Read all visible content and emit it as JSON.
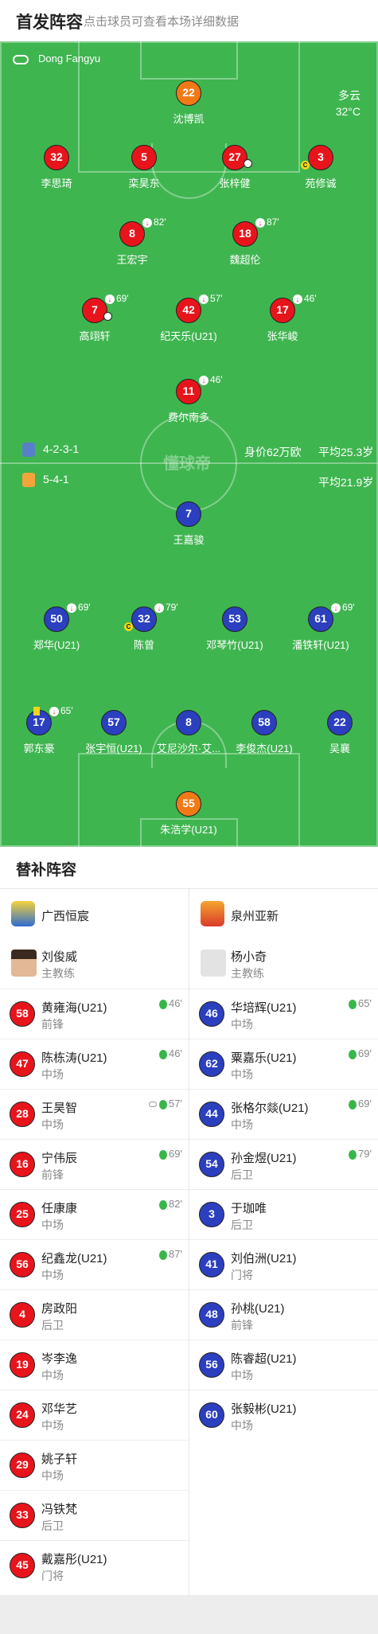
{
  "header": {
    "title": "首发阵容",
    "subtitle": "点击球员可查看本场详细数据"
  },
  "field": {
    "referee": "Dong Fangyu",
    "weather": {
      "condition": "多云",
      "temp": "32°C"
    },
    "watermark": "懂球帝",
    "home_team": {
      "formation": "4-2-3-1",
      "value": "身价62万欧",
      "avg_age": "平均25.3岁"
    },
    "away_team": {
      "formation": "5-4-1",
      "avg_age": "平均21.9岁"
    }
  },
  "players": [
    {
      "num": "22",
      "name": "沈博凯",
      "color": "orange"
    },
    {
      "num": "32",
      "name": "李思琦",
      "color": "red"
    },
    {
      "num": "5",
      "name": "栾昊东",
      "color": "red"
    },
    {
      "num": "27",
      "name": "张梓健",
      "color": "red"
    },
    {
      "num": "3",
      "name": "苑修诚",
      "color": "red"
    },
    {
      "num": "8",
      "name": "王宏宇",
      "color": "red",
      "sub": "82'"
    },
    {
      "num": "18",
      "name": "魏超伦",
      "color": "red",
      "sub": "87'"
    },
    {
      "num": "7",
      "name": "高翊轩",
      "color": "red",
      "sub": "69'"
    },
    {
      "num": "42",
      "name": "纪天乐(U21)",
      "color": "red",
      "sub": "57'"
    },
    {
      "num": "17",
      "name": "张华峻",
      "color": "red",
      "sub": "46'"
    },
    {
      "num": "11",
      "name": "费尔南多",
      "color": "red",
      "sub": "46'"
    },
    {
      "num": "7",
      "name": "王嘉骏",
      "color": "blue"
    },
    {
      "num": "50",
      "name": "郑华(U21)",
      "color": "blue",
      "sub": "69'"
    },
    {
      "num": "32",
      "name": "陈曾",
      "color": "blue",
      "sub": "79'"
    },
    {
      "num": "53",
      "name": "邓琴竹(U21)",
      "color": "blue"
    },
    {
      "num": "61",
      "name": "潘铁轩(U21)",
      "color": "blue",
      "sub": "69'"
    },
    {
      "num": "17",
      "name": "郭东豪",
      "color": "blue",
      "sub": "65'"
    },
    {
      "num": "57",
      "name": "张宇恒(U21)",
      "color": "blue"
    },
    {
      "num": "8",
      "name": "艾尼沙尔·艾...",
      "color": "blue"
    },
    {
      "num": "58",
      "name": "李俊杰(U21)",
      "color": "blue"
    },
    {
      "num": "22",
      "name": "吴襄",
      "color": "blue"
    },
    {
      "num": "55",
      "name": "朱浩学(U21)",
      "color": "orange"
    }
  ],
  "subs": {
    "title": "替补阵容",
    "home": {
      "team": "广西恒宸",
      "coach": {
        "name": "刘俊威",
        "role": "主教练"
      },
      "players": [
        {
          "num": "58",
          "name": "黄雍海(U21)",
          "pos": "前锋",
          "min": "46'"
        },
        {
          "num": "47",
          "name": "陈栋涛(U21)",
          "pos": "中场",
          "min": "46'"
        },
        {
          "num": "28",
          "name": "王昊智",
          "pos": "中场",
          "min": "57'"
        },
        {
          "num": "16",
          "name": "宁伟辰",
          "pos": "前锋",
          "min": "69'"
        },
        {
          "num": "25",
          "name": "任康康",
          "pos": "中场",
          "min": "82'"
        },
        {
          "num": "56",
          "name": "纪鑫龙(U21)",
          "pos": "中场",
          "min": "87'"
        },
        {
          "num": "4",
          "name": "房政阳",
          "pos": "后卫",
          "min": ""
        },
        {
          "num": "19",
          "name": "岑李逸",
          "pos": "中场",
          "min": ""
        },
        {
          "num": "24",
          "name": "邓华艺",
          "pos": "中场",
          "min": ""
        },
        {
          "num": "29",
          "name": "姚子轩",
          "pos": "中场",
          "min": ""
        },
        {
          "num": "33",
          "name": "冯铁梵",
          "pos": "后卫",
          "min": ""
        },
        {
          "num": "45",
          "name": "戴嘉彤(U21)",
          "pos": "门将",
          "min": ""
        }
      ]
    },
    "away": {
      "team": "泉州亚新",
      "coach": {
        "name": "杨小奇",
        "role": "主教练"
      },
      "players": [
        {
          "num": "46",
          "name": "华培辉(U21)",
          "pos": "中场",
          "min": "65'"
        },
        {
          "num": "62",
          "name": "粟嘉乐(U21)",
          "pos": "中场",
          "min": "69'"
        },
        {
          "num": "44",
          "name": "张格尔燚(U21)",
          "pos": "中场",
          "min": "69'"
        },
        {
          "num": "54",
          "name": "孙金煜(U21)",
          "pos": "后卫",
          "min": "79'"
        },
        {
          "num": "3",
          "name": "于珈唯",
          "pos": "后卫",
          "min": ""
        },
        {
          "num": "41",
          "name": "刘伯洲(U21)",
          "pos": "门将",
          "min": ""
        },
        {
          "num": "48",
          "name": "孙桃(U21)",
          "pos": "前锋",
          "min": ""
        },
        {
          "num": "56",
          "name": "陈睿超(U21)",
          "pos": "中场",
          "min": ""
        },
        {
          "num": "60",
          "name": "张毅彬(U21)",
          "pos": "中场",
          "min": ""
        }
      ]
    }
  }
}
